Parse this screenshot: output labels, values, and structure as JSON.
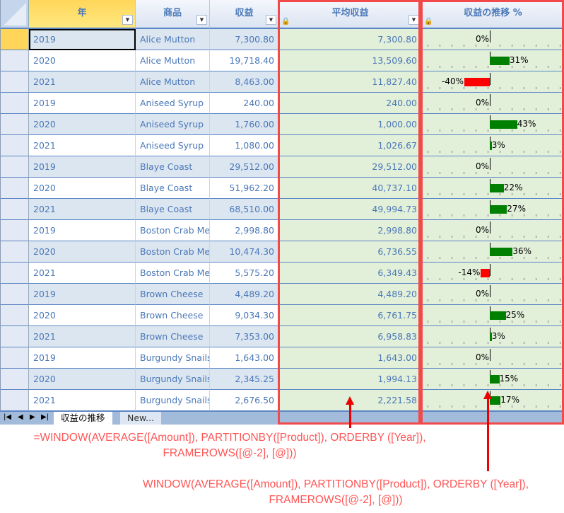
{
  "columns": {
    "year": "年",
    "product": "商品",
    "amount": "収益",
    "avg": "平均収益",
    "trend": "収益の推移 %"
  },
  "rows": [
    {
      "year": "2019",
      "product": "Alice Mutton",
      "amount": "7,300.80",
      "avg": "7,300.80",
      "pct": 0,
      "pct_label": "0%"
    },
    {
      "year": "2020",
      "product": "Alice Mutton",
      "amount": "19,718.40",
      "avg": "13,509.60",
      "pct": 31,
      "pct_label": "31%"
    },
    {
      "year": "2021",
      "product": "Alice Mutton",
      "amount": "8,463.00",
      "avg": "11,827.40",
      "pct": -40,
      "pct_label": "-40%"
    },
    {
      "year": "2019",
      "product": "Aniseed Syrup",
      "amount": "240.00",
      "avg": "240.00",
      "pct": 0,
      "pct_label": "0%"
    },
    {
      "year": "2020",
      "product": "Aniseed Syrup",
      "amount": "1,760.00",
      "avg": "1,000.00",
      "pct": 43,
      "pct_label": "43%"
    },
    {
      "year": "2021",
      "product": "Aniseed Syrup",
      "amount": "1,080.00",
      "avg": "1,026.67",
      "pct": 3,
      "pct_label": "3%"
    },
    {
      "year": "2019",
      "product": "Blaye Coast",
      "amount": "29,512.00",
      "avg": "29,512.00",
      "pct": 0,
      "pct_label": "0%"
    },
    {
      "year": "2020",
      "product": "Blaye Coast",
      "amount": "51,962.20",
      "avg": "40,737.10",
      "pct": 22,
      "pct_label": "22%"
    },
    {
      "year": "2021",
      "product": "Blaye Coast",
      "amount": "68,510.00",
      "avg": "49,994.73",
      "pct": 27,
      "pct_label": "27%"
    },
    {
      "year": "2019",
      "product": "Boston Crab Me",
      "amount": "2,998.80",
      "avg": "2,998.80",
      "pct": 0,
      "pct_label": "0%"
    },
    {
      "year": "2020",
      "product": "Boston Crab Me",
      "amount": "10,474.30",
      "avg": "6,736.55",
      "pct": 36,
      "pct_label": "36%"
    },
    {
      "year": "2021",
      "product": "Boston Crab Me",
      "amount": "5,575.20",
      "avg": "6,349.43",
      "pct": -14,
      "pct_label": "-14%"
    },
    {
      "year": "2019",
      "product": "Brown Cheese",
      "amount": "4,489.20",
      "avg": "4,489.20",
      "pct": 0,
      "pct_label": "0%"
    },
    {
      "year": "2020",
      "product": "Brown Cheese",
      "amount": "9,034.30",
      "avg": "6,761.75",
      "pct": 25,
      "pct_label": "25%"
    },
    {
      "year": "2021",
      "product": "Brown Cheese",
      "amount": "7,353.00",
      "avg": "6,958.83",
      "pct": 3,
      "pct_label": "3%"
    },
    {
      "year": "2019",
      "product": "Burgundy Snails",
      "amount": "1,643.00",
      "avg": "1,643.00",
      "pct": 0,
      "pct_label": "0%"
    },
    {
      "year": "2020",
      "product": "Burgundy Snails",
      "amount": "2,345.25",
      "avg": "1,994.13",
      "pct": 15,
      "pct_label": "15%"
    },
    {
      "year": "2021",
      "product": "Burgundy Snails",
      "amount": "2,676.50",
      "avg": "2,221.58",
      "pct": 17,
      "pct_label": "17%"
    }
  ],
  "tabs": {
    "active": "収益の推移",
    "new": "New..."
  },
  "annotations": {
    "avg_formula": "=WINDOW(AVERAGE([Amount]), PARTITIONBY([Product]), ORDERBY ([Year]), FRAMEROWS([@-2], [@]))",
    "trend_formula": "WINDOW(AVERAGE([Amount]), PARTITIONBY([Product]), ORDERBY ([Year]), FRAMEROWS([@-2], [@]))"
  },
  "colors": {
    "positive": "#008000",
    "negative": "#ff0000",
    "annotation": "#f24a4a"
  }
}
